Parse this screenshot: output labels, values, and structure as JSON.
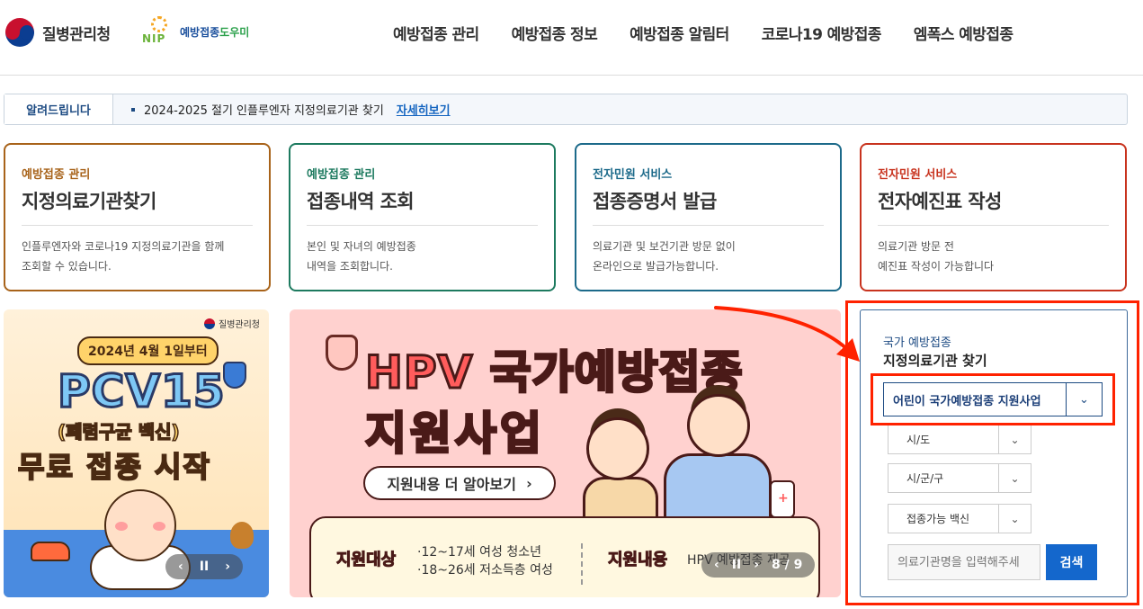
{
  "header": {
    "org_name": "질병관리청",
    "nip_mark": "NIP",
    "nip_name_a": "예방접종",
    "nip_name_b": "도우미",
    "nav": [
      "예방접종 관리",
      "예방접종 정보",
      "예방접종 알림터",
      "코로나19 예방접종",
      "엠폭스 예방접종"
    ]
  },
  "notice": {
    "label": "알려드립니다",
    "text": "2024-2025 절기 인플루엔자 지정의료기관 찾기",
    "link": "자세히보기"
  },
  "cards": [
    {
      "category": "예방접종 관리",
      "title": "지정의료기관찾기",
      "desc1": "인플루엔자와 코로나19 지정의료기관을 함께",
      "desc2": "조회할 수 있습니다.",
      "color": "#a8631a"
    },
    {
      "category": "예방접종 관리",
      "title": "접종내역 조회",
      "desc1": "본인 및 자녀의 예방접종",
      "desc2": "내역을 조회합니다.",
      "color": "#1d7a5f"
    },
    {
      "category": "전자민원 서비스",
      "title": "접종증명서 발급",
      "desc1": "의료기관 및 보건기관 방문 없이",
      "desc2": "온라인으로 발급가능합니다.",
      "color": "#1c6a8a"
    },
    {
      "category": "전자민원 서비스",
      "title": "전자예진표 작성",
      "desc1": "의료기관 방문 전",
      "desc2": "예진표 작성이 가능합니다",
      "color": "#c8331e"
    }
  ],
  "banner_pcv": {
    "brand": "질병관리청",
    "date": "2024년 4월 1일부터",
    "headline": "PCV15",
    "sub": "(폐렴구균 백신)",
    "start": "무료 접종 시작",
    "prev": "‹",
    "pause": "II",
    "next": "›"
  },
  "banner_hpv": {
    "title1": "HPV 국가예방접종",
    "title2": "지원사업",
    "more": "지원내용 더 알아보기",
    "more_arrow": "›",
    "tag1": "지원대상",
    "target1": "·12~17세 여성 청소년",
    "target2": "·18~26세 저소득층 여성",
    "tag2": "지원내용",
    "content": "HPV 예방접종 제공",
    "prev": "‹",
    "pause": "II",
    "next": "›",
    "counter": "8 / 9"
  },
  "search": {
    "category": "국가 예방접종",
    "title": "지정의료기관 찾기",
    "program": "어린이 국가예방접종 지원사업",
    "sido": "시/도",
    "sigungu": "시/군/구",
    "vaccine": "접종가능 백신",
    "input_placeholder": "의료기관명을 입력해주세",
    "button": "검색"
  }
}
